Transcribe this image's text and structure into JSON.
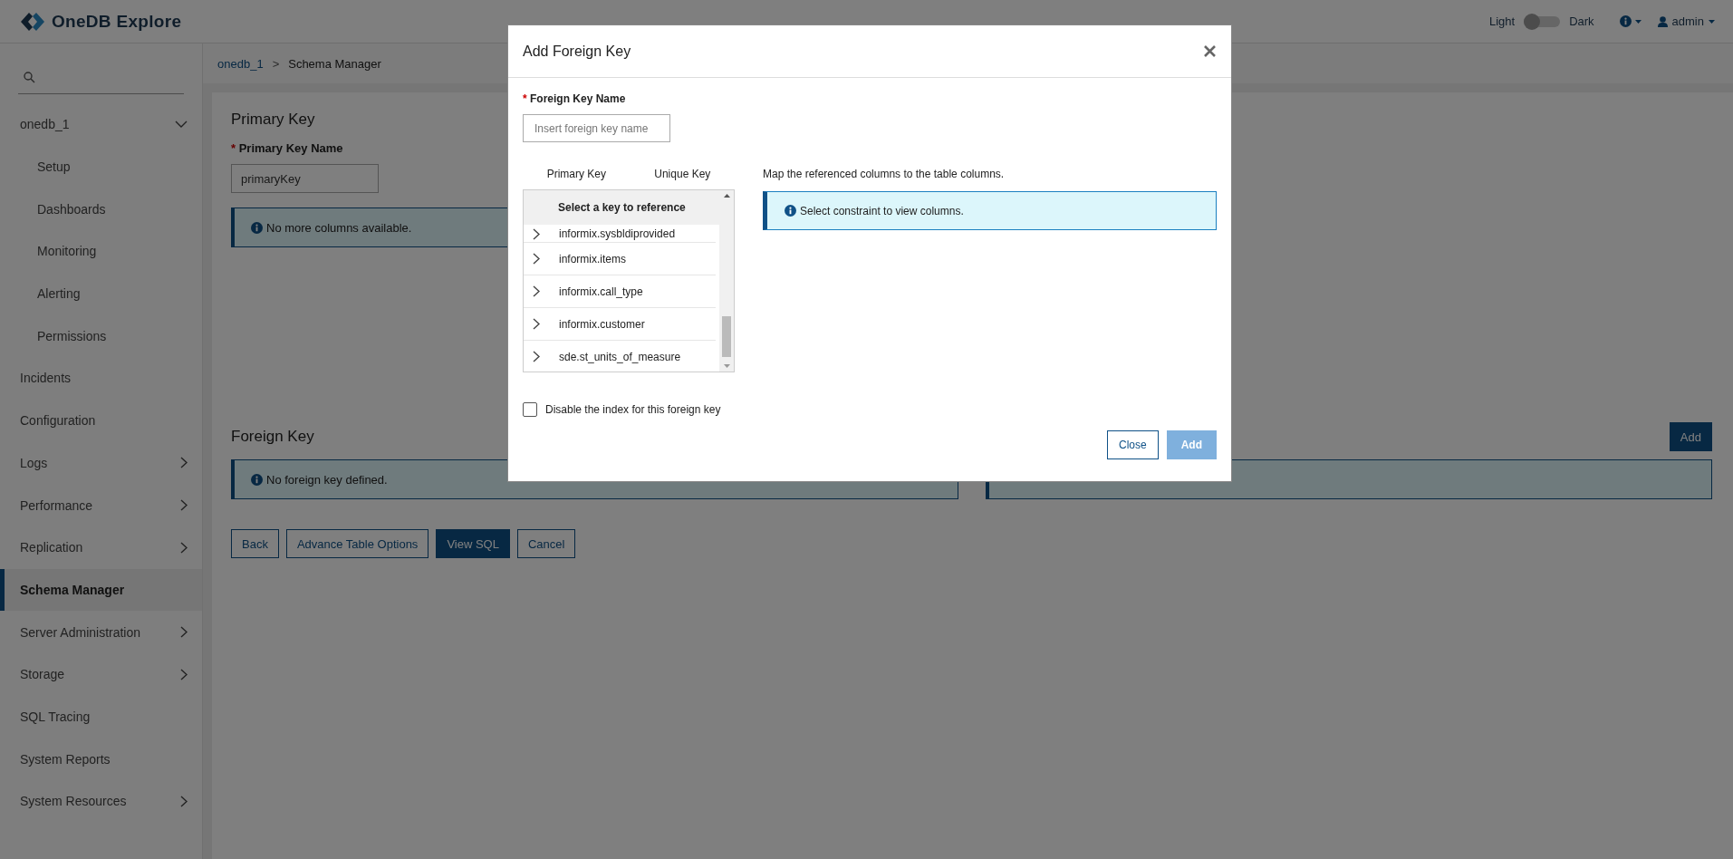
{
  "app": {
    "title": "OneDB Explore"
  },
  "header": {
    "theme_toggle": {
      "left_label": "Light",
      "right_label": "Dark",
      "on": false
    },
    "user": "admin"
  },
  "sidebar": {
    "items": [
      {
        "label": "onedb_1",
        "selected": false,
        "expandable": true,
        "expanded": true,
        "children": [
          {
            "label": "Setup",
            "selected": false
          },
          {
            "label": "Dashboards",
            "selected": false
          },
          {
            "label": "Monitoring",
            "selected": false
          },
          {
            "label": "Alerting",
            "selected": false
          },
          {
            "label": "Permissions",
            "selected": false
          }
        ]
      },
      {
        "label": "Incidents",
        "selected": false,
        "expandable": false,
        "expanded": false
      },
      {
        "label": "Configuration",
        "selected": false,
        "expandable": false,
        "expanded": false
      },
      {
        "label": "Logs",
        "selected": false,
        "expandable": true,
        "expanded": false
      },
      {
        "label": "Performance",
        "selected": false,
        "expandable": true,
        "expanded": false
      },
      {
        "label": "Replication",
        "selected": false,
        "expandable": true,
        "expanded": false
      },
      {
        "label": "Schema Manager",
        "selected": true,
        "expandable": false,
        "expanded": false
      },
      {
        "label": "Server Administration",
        "selected": false,
        "expandable": true,
        "expanded": false
      },
      {
        "label": "Storage",
        "selected": false,
        "expandable": true,
        "expanded": false
      },
      {
        "label": "SQL Tracing",
        "selected": false,
        "expandable": false,
        "expanded": false
      },
      {
        "label": "System Reports",
        "selected": false,
        "expandable": false,
        "expanded": false
      },
      {
        "label": "System Resources",
        "selected": false,
        "expandable": true,
        "expanded": false
      }
    ]
  },
  "breadcrumb": [
    {
      "label": "onedb_1",
      "kind": "link"
    },
    {
      "label": ">",
      "kind": "separator"
    },
    {
      "label": "Schema Manager",
      "kind": "current"
    }
  ],
  "primary_key": {
    "heading": "Primary Key",
    "field_label": "Primary Key Name",
    "required_mark": "*",
    "value": "primaryKey",
    "alert": "No more columns available."
  },
  "foreign_key": {
    "heading": "Foreign Key",
    "add_button": "Add",
    "alert": "No foreign key defined."
  },
  "actions": [
    {
      "label": "Back",
      "primary": false
    },
    {
      "label": "Advance Table Options",
      "primary": false
    },
    {
      "label": "View SQL",
      "primary": true
    },
    {
      "label": "Cancel",
      "primary": false
    }
  ],
  "dialog": {
    "title": "Add Foreign Key",
    "field_label": "Foreign Key Name",
    "required_mark": "*",
    "placeholder": "Insert foreign key name",
    "tabs": [
      {
        "label": "Primary Key",
        "selected": false
      },
      {
        "label": "Unique Key",
        "selected": false
      }
    ],
    "list_header": "Select a key to reference",
    "rows": [
      {
        "label": "informix.sysbldiprovided",
        "expanded": false,
        "cut": true
      },
      {
        "label": "informix.items",
        "expanded": false,
        "cut": false
      },
      {
        "label": "informix.call_type",
        "expanded": false,
        "cut": false
      },
      {
        "label": "informix.customer",
        "expanded": false,
        "cut": false
      },
      {
        "label": "sde.st_units_of_measure",
        "expanded": false,
        "cut": false
      }
    ],
    "hint": "Map the referenced columns to the table columns.",
    "info": "Select constraint to view columns.",
    "checkbox": {
      "label": "Disable the index for this foreign key",
      "checked": false
    },
    "buttons": [
      {
        "label": "Close",
        "primary": false,
        "disabled": false
      },
      {
        "label": "Add",
        "primary": true,
        "disabled": true
      }
    ]
  }
}
